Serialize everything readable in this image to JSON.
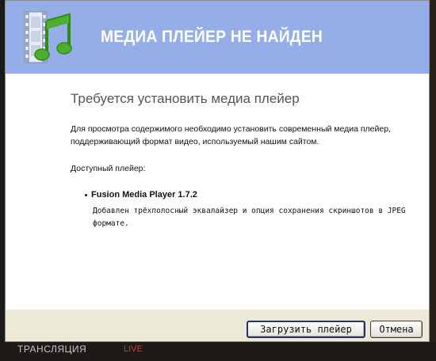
{
  "dialog": {
    "header_title": "МЕДИА ПЛЕЙЕР НЕ НАЙДЕН",
    "heading": "Требуется установить медиа плейер",
    "paragraph_line1": "Для просмотра содержимого необходимо установить современный медиа плейер,",
    "paragraph_line2": "поддерживающий формат видео, используемый нашим сайтом.",
    "available_label": "Доступный плейер:",
    "player": {
      "name": "Fusion Media Player 1.7.2",
      "description_line1": "Добавлен трёхполосный эквалайзер и опция сохранения скриншотов в JPEG",
      "description_line2": "формате."
    },
    "buttons": {
      "download_label": "Загрузить плейер",
      "cancel_label": "Отмена"
    },
    "logo_icon": "music-note-film-icon"
  },
  "background": {
    "bottom_text": "ТРАНСЛЯЦИЯ",
    "bottom_red_text": "LIVE"
  },
  "colors": {
    "header_bg": "#96aee8",
    "footer_bg": "#ece9d8",
    "logo_green": "#4caf2e"
  }
}
